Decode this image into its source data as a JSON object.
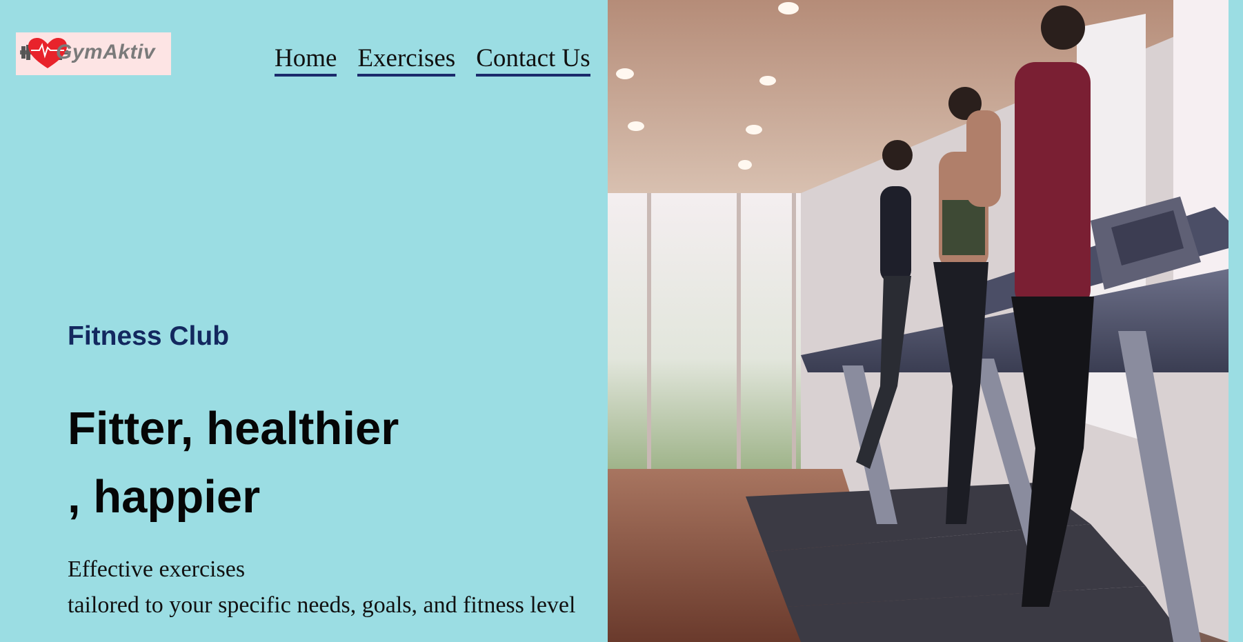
{
  "logo": {
    "text": "GymAktiv",
    "icon": "heart-dumbbell-icon",
    "brand_color": "#e8232b"
  },
  "nav": {
    "items": [
      {
        "label": "Home"
      },
      {
        "label": "Exercises"
      },
      {
        "label": "Contact Us"
      }
    ]
  },
  "hero": {
    "eyebrow": "Fitness Club",
    "headline_line1": "Fitter, healthier",
    "headline_line2": ", happier",
    "description_line1": "Effective exercises",
    "description_line2": "tailored to your specific needs, goals, and fitness level",
    "image": "gym-treadmill-runners-photo"
  },
  "colors": {
    "background": "#9bdde3",
    "eyebrow": "#13285f",
    "nav_underline": "#1a2a6b"
  }
}
